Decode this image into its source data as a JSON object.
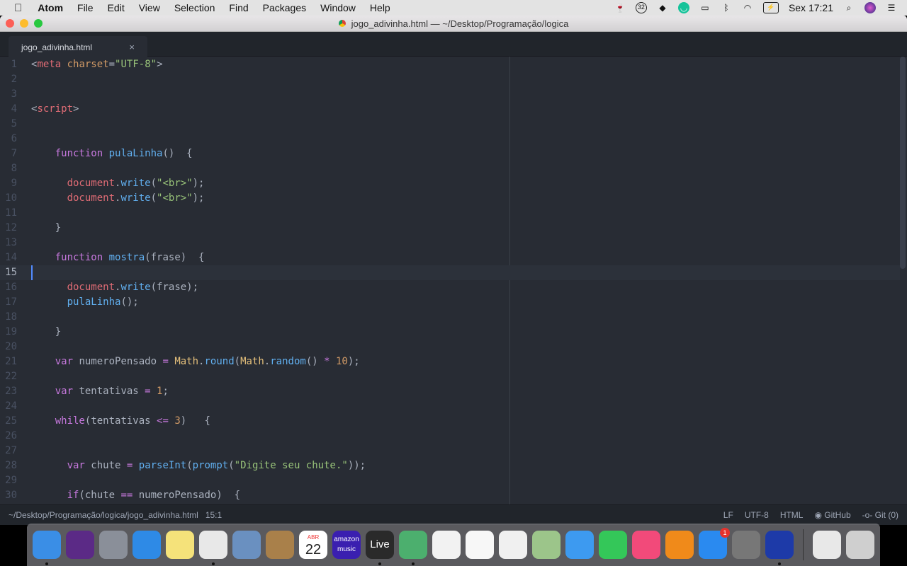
{
  "menubar": {
    "app": "Atom",
    "items": [
      "File",
      "Edit",
      "View",
      "Selection",
      "Find",
      "Packages",
      "Window",
      "Help"
    ],
    "clock": "Sex 17:21",
    "status_icons": [
      "wine-glass-icon",
      "32-badge-icon",
      "frog-icon",
      "grammarly-icon",
      "airplay-icon",
      "bluetooth-icon",
      "wifi-icon",
      "battery-icon",
      "search-icon",
      "siri-icon",
      "list-icon"
    ],
    "status_badge": "32"
  },
  "window": {
    "title": "jogo_adivinha.html — ~/Desktop/Programação/logica"
  },
  "tab": {
    "label": "jogo_adivinha.html",
    "close": "×"
  },
  "editor": {
    "current_line": 15,
    "lines": [
      [
        [
          "<",
          "punc"
        ],
        [
          "meta",
          "tag"
        ],
        [
          " ",
          "punc"
        ],
        [
          "charset",
          "attr"
        ],
        [
          "=",
          "punc"
        ],
        [
          "\"UTF-8\"",
          "str"
        ],
        [
          ">",
          "punc"
        ]
      ],
      [],
      [],
      [
        [
          "<",
          "punc"
        ],
        [
          "script",
          "tag"
        ],
        [
          ">",
          "punc"
        ]
      ],
      [],
      [],
      [
        [
          "    ",
          "punc"
        ],
        [
          "function",
          "kw"
        ],
        [
          " ",
          "punc"
        ],
        [
          "pulaLinha",
          "fn"
        ],
        [
          "()  {",
          "punc"
        ]
      ],
      [],
      [
        [
          "      ",
          "punc"
        ],
        [
          "document",
          "doc"
        ],
        [
          ".",
          "punc"
        ],
        [
          "write",
          "fn"
        ],
        [
          "(",
          "punc"
        ],
        [
          "\"<br>\"",
          "str"
        ],
        [
          ");",
          "punc"
        ]
      ],
      [
        [
          "      ",
          "punc"
        ],
        [
          "document",
          "doc"
        ],
        [
          ".",
          "punc"
        ],
        [
          "write",
          "fn"
        ],
        [
          "(",
          "punc"
        ],
        [
          "\"<br>\"",
          "str"
        ],
        [
          ");",
          "punc"
        ]
      ],
      [],
      [
        [
          "    }",
          "punc"
        ]
      ],
      [],
      [
        [
          "    ",
          "punc"
        ],
        [
          "function",
          "kw"
        ],
        [
          " ",
          "punc"
        ],
        [
          "mostra",
          "fn"
        ],
        [
          "(frase)  {",
          "punc"
        ]
      ],
      [],
      [
        [
          "      ",
          "punc"
        ],
        [
          "document",
          "doc"
        ],
        [
          ".",
          "punc"
        ],
        [
          "write",
          "fn"
        ],
        [
          "(frase);",
          "punc"
        ]
      ],
      [
        [
          "      ",
          "punc"
        ],
        [
          "pulaLinha",
          "fn"
        ],
        [
          "();",
          "punc"
        ]
      ],
      [],
      [
        [
          "    }",
          "punc"
        ]
      ],
      [],
      [
        [
          "    ",
          "punc"
        ],
        [
          "var",
          "kw"
        ],
        [
          " numeroPensado ",
          "punc"
        ],
        [
          "=",
          "op"
        ],
        [
          " ",
          "punc"
        ],
        [
          "Math",
          "obj"
        ],
        [
          ".",
          "punc"
        ],
        [
          "round",
          "fn"
        ],
        [
          "(",
          "punc"
        ],
        [
          "Math",
          "obj"
        ],
        [
          ".",
          "punc"
        ],
        [
          "random",
          "fn"
        ],
        [
          "() ",
          "punc"
        ],
        [
          "*",
          "op"
        ],
        [
          " ",
          "punc"
        ],
        [
          "10",
          "num"
        ],
        [
          ");",
          "punc"
        ]
      ],
      [],
      [
        [
          "    ",
          "punc"
        ],
        [
          "var",
          "kw"
        ],
        [
          " tentativas ",
          "punc"
        ],
        [
          "=",
          "op"
        ],
        [
          " ",
          "punc"
        ],
        [
          "1",
          "num"
        ],
        [
          ";",
          "punc"
        ]
      ],
      [],
      [
        [
          "    ",
          "punc"
        ],
        [
          "while",
          "kw"
        ],
        [
          "(tentativas ",
          "punc"
        ],
        [
          "<=",
          "op"
        ],
        [
          " ",
          "punc"
        ],
        [
          "3",
          "num"
        ],
        [
          ")   {",
          "punc"
        ]
      ],
      [],
      [],
      [
        [
          "      ",
          "punc"
        ],
        [
          "var",
          "kw"
        ],
        [
          " chute ",
          "punc"
        ],
        [
          "=",
          "op"
        ],
        [
          " ",
          "punc"
        ],
        [
          "parseInt",
          "fn"
        ],
        [
          "(",
          "punc"
        ],
        [
          "prompt",
          "fn"
        ],
        [
          "(",
          "punc"
        ],
        [
          "\"Digite seu chute.\"",
          "str"
        ],
        [
          "));",
          "punc"
        ]
      ],
      [],
      [
        [
          "      ",
          "punc"
        ],
        [
          "if",
          "kw"
        ],
        [
          "(chute ",
          "punc"
        ],
        [
          "==",
          "op"
        ],
        [
          " numeroPensado)  {",
          "punc"
        ]
      ]
    ]
  },
  "statusbar": {
    "path": "~/Desktop/Programação/logica/jogo_adivinha.html",
    "cursor": "15:1",
    "line_ending": "LF",
    "encoding": "UTF-8",
    "grammar": "HTML",
    "github": "GitHub",
    "git": "Git (0)"
  },
  "dock": {
    "items": [
      {
        "name": "finder",
        "color": "#3a8ee6",
        "running": true
      },
      {
        "name": "siri",
        "color": "#5b2a86"
      },
      {
        "name": "launchpad",
        "color": "#8a8f99"
      },
      {
        "name": "safari",
        "color": "#2e8ae6"
      },
      {
        "name": "notes",
        "color": "#f5e27a"
      },
      {
        "name": "chrome",
        "color": "#e8e8e8",
        "running": true
      },
      {
        "name": "preview",
        "color": "#6a90c0"
      },
      {
        "name": "contacts",
        "color": "#a9804a"
      },
      {
        "name": "calendar",
        "color": "#ffffff",
        "label": "22",
        "sublabel": "ABR"
      },
      {
        "name": "amazon-music",
        "color": "#3a1fb0",
        "label": "amazon music"
      },
      {
        "name": "live",
        "color": "#2a2a2a",
        "label": "Live",
        "running": true
      },
      {
        "name": "atom",
        "color": "#4caf6e",
        "running": true
      },
      {
        "name": "textedit",
        "color": "#f2f2f2"
      },
      {
        "name": "reminders",
        "color": "#f7f7f7"
      },
      {
        "name": "photos",
        "color": "#f0f0f0"
      },
      {
        "name": "maps",
        "color": "#9cc58a"
      },
      {
        "name": "messages",
        "color": "#3d9af0"
      },
      {
        "name": "facetime",
        "color": "#34c759"
      },
      {
        "name": "itunes",
        "color": "#f24a7a"
      },
      {
        "name": "ibooks",
        "color": "#f08a1a"
      },
      {
        "name": "app-store",
        "color": "#2a8af0",
        "badge": "1"
      },
      {
        "name": "system-preferences",
        "color": "#777"
      },
      {
        "name": "fetch",
        "color": "#1d3aa8",
        "running": true
      }
    ],
    "right": [
      {
        "name": "music-folder",
        "color": "#e8e8e8"
      },
      {
        "name": "trash",
        "color": "#cfcfcf"
      }
    ]
  }
}
